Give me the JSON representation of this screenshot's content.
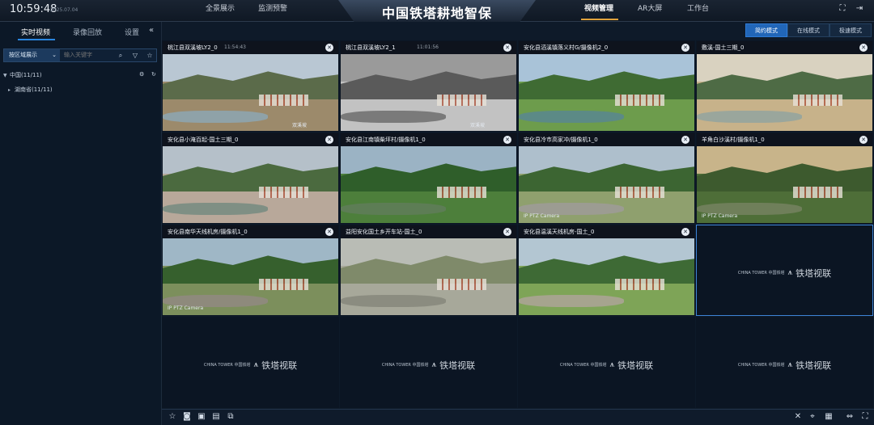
{
  "header": {
    "time": "10:59:48",
    "date": "2025.07.04",
    "title": "中国铁塔耕地智保",
    "nav_left": [
      "全景展示",
      "监测预警"
    ],
    "nav_right": [
      "视频管理",
      "AR大屏",
      "工作台"
    ],
    "active_nav": "视频管理",
    "icons": [
      "fullscreen-icon",
      "logout-icon"
    ]
  },
  "sidebar": {
    "tabs": [
      "实时视频",
      "录像回放",
      "设置"
    ],
    "active_tab": "实时视频",
    "collapse_icon": "«",
    "filter": {
      "dropdown_value": "按区域展示",
      "placeholder": "输入关键字"
    },
    "tree": [
      {
        "label": "中国(11/11)",
        "expanded": true
      },
      {
        "label": "湖南省(11/11)",
        "expanded": false
      }
    ]
  },
  "modes": [
    "简约模式",
    "在线模式",
    "极速模式"
  ],
  "active_mode": "简约模式",
  "cells": [
    {
      "title": "桃江县双溪坡LY2_0",
      "stamp": "11:54:43",
      "caption": "双溪坡",
      "scene": "river"
    },
    {
      "title": "桃江县双溪坡LY2_1",
      "stamp": "11:01:56",
      "caption": "双溪坡",
      "scene": "gray"
    },
    {
      "title": "安化县滔溪镇落义村G/摄像机2_0",
      "stamp": "",
      "caption": "",
      "scene": "valley"
    },
    {
      "title": "敷溪-国土三期_0",
      "stamp": "",
      "caption": "",
      "scene": "lake"
    },
    {
      "title": "安化县小淹百起-国土三期_0",
      "stamp": "",
      "caption": "",
      "scene": "town"
    },
    {
      "title": "安化县江南镇柴坪村/摄像机1_0",
      "stamp": "",
      "caption": "",
      "scene": "forest"
    },
    {
      "title": "安化县冷市高家冲/摄像机1_0",
      "stamp": "",
      "caption": "IP PTZ Camera",
      "scene": "village"
    },
    {
      "title": "羊角白沙溪村/摄像机1_0",
      "stamp": "",
      "caption": "IP PTZ Camera",
      "scene": "mountain"
    },
    {
      "title": "安化县南华天线机房/摄像机1_0",
      "stamp": "",
      "caption": "IP PTZ Camera",
      "scene": "hillside"
    },
    {
      "title": "益阳安化国土乡开车站-国土_0",
      "stamp": "",
      "caption": "",
      "scene": "tower"
    },
    {
      "title": "安化县温溪天线机房-国土_0",
      "stamp": "",
      "caption": "",
      "scene": "farm"
    },
    {
      "title": "",
      "stamp": "",
      "caption": "",
      "scene": "empty"
    },
    {
      "title": "",
      "stamp": "",
      "caption": "",
      "scene": "empty"
    },
    {
      "title": "",
      "stamp": "",
      "caption": "",
      "scene": "empty"
    },
    {
      "title": "",
      "stamp": "",
      "caption": "",
      "scene": "empty"
    },
    {
      "title": "",
      "stamp": "",
      "caption": "",
      "scene": "empty"
    }
  ],
  "watermark": {
    "small": "CHINA TOWER 中国铁塔",
    "big": "铁塔视联"
  },
  "bottom_icons_left": [
    "star-icon",
    "camera-icon",
    "record-icon",
    "snapshot-list-icon",
    "multi-window-icon"
  ],
  "bottom_icons_right": [
    "mute-icon",
    "focus-icon",
    "layout-icon",
    "stretch-icon",
    "fullscreen-icon"
  ],
  "colors": {
    "accent": "#2166b8",
    "nav_underline": "#e0a23c",
    "selected_border": "#3d83d6"
  }
}
